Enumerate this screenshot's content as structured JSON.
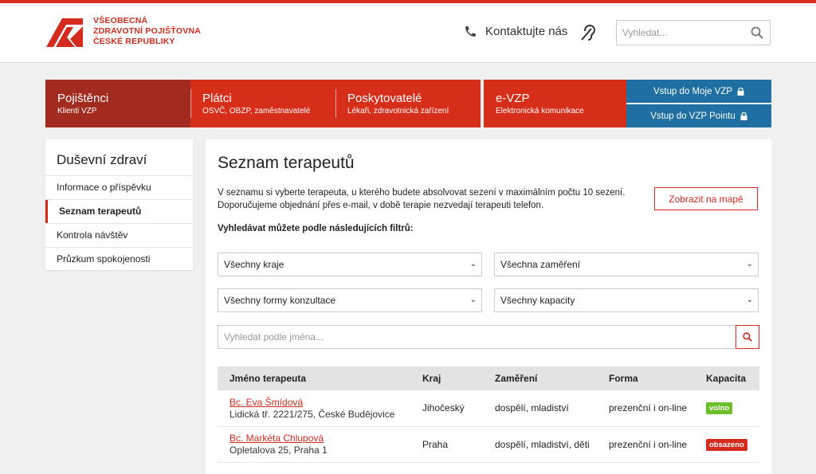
{
  "colors": {
    "brand_red": "#d52b1e",
    "nav_dark_red": "#a32a1f",
    "nav_red": "#d72e19",
    "login_blue": "#1f6fa3",
    "badge_free": "#6bbf2a",
    "badge_full": "#d52b1e"
  },
  "header": {
    "logo_lines": [
      "VŠEOBECNÁ",
      "ZDRAVOTNÍ POJIŠŤOVNA",
      "ČESKÉ REPUBLIKY"
    ],
    "contact_label": "Kontaktujte nás",
    "contact_icon": "phone-icon",
    "hearing_icon": "hearing-impaired-icon",
    "search_placeholder": "Vyhledat..."
  },
  "nav": [
    {
      "title": "Pojištěnci",
      "subtitle": "Klienti VZP"
    },
    {
      "title": "Plátci",
      "subtitle": "OSVČ, OBZP, zaměstnavatelé"
    },
    {
      "title": "Poskytovatelé",
      "subtitle": "Lékaři, zdravotnická zařízení"
    },
    {
      "title": "e-VZP",
      "subtitle": "Elektronická komunikace"
    }
  ],
  "login": [
    {
      "label": "Vstup do Moje VZP",
      "icon": "lock-icon"
    },
    {
      "label": "Vstup do VZP Pointu",
      "icon": "lock-icon"
    }
  ],
  "sidebar": {
    "title": "Duševní zdraví",
    "items": [
      {
        "label": "Informace o příspěvku"
      },
      {
        "label": "Seznam terapeutů"
      },
      {
        "label": "Kontrola návštěv"
      },
      {
        "label": "Průzkum spokojenosti"
      }
    ]
  },
  "main": {
    "title": "Seznam terapeutů",
    "intro_line1": "V seznamu si vyberte terapeuta, u kterého budete absolvovat sezení v maximálním počtu 10 sezení.",
    "intro_line2": "Doporučujeme objednání přes e-mail, v době terapie nezvedají terapeuti telefon.",
    "map_button": "Zobrazit na mapě",
    "filters_title": "Vyhledávat můžete podle následujících filtrů:",
    "filters": {
      "region": "Všechny kraje",
      "focus": "Všechna zaměření",
      "form": "Všechny formy konzultace",
      "capacity": "Všechny kapacity"
    },
    "name_search_placeholder": "Vyhledat podle jména..."
  },
  "table": {
    "columns": [
      "Jméno terapeuta",
      "Kraj",
      "Zaměření",
      "Forma",
      "Kapacita"
    ],
    "rows": [
      {
        "name": "Bc. Eva Šmídová",
        "address": "Lidická tř. 2221/275, České Budějovice",
        "region": "Jihočeský",
        "focus": "dospělí, mladiství",
        "form": "prezenční i on-line",
        "capacity": "volno"
      },
      {
        "name": "Bc. Markéta Chlupová",
        "address": "Opletalova 25, Praha 1",
        "region": "Praha",
        "focus": "dospělí, mladiství, děti",
        "form": "prezenční i on-line",
        "capacity": "obsazeno"
      }
    ]
  }
}
